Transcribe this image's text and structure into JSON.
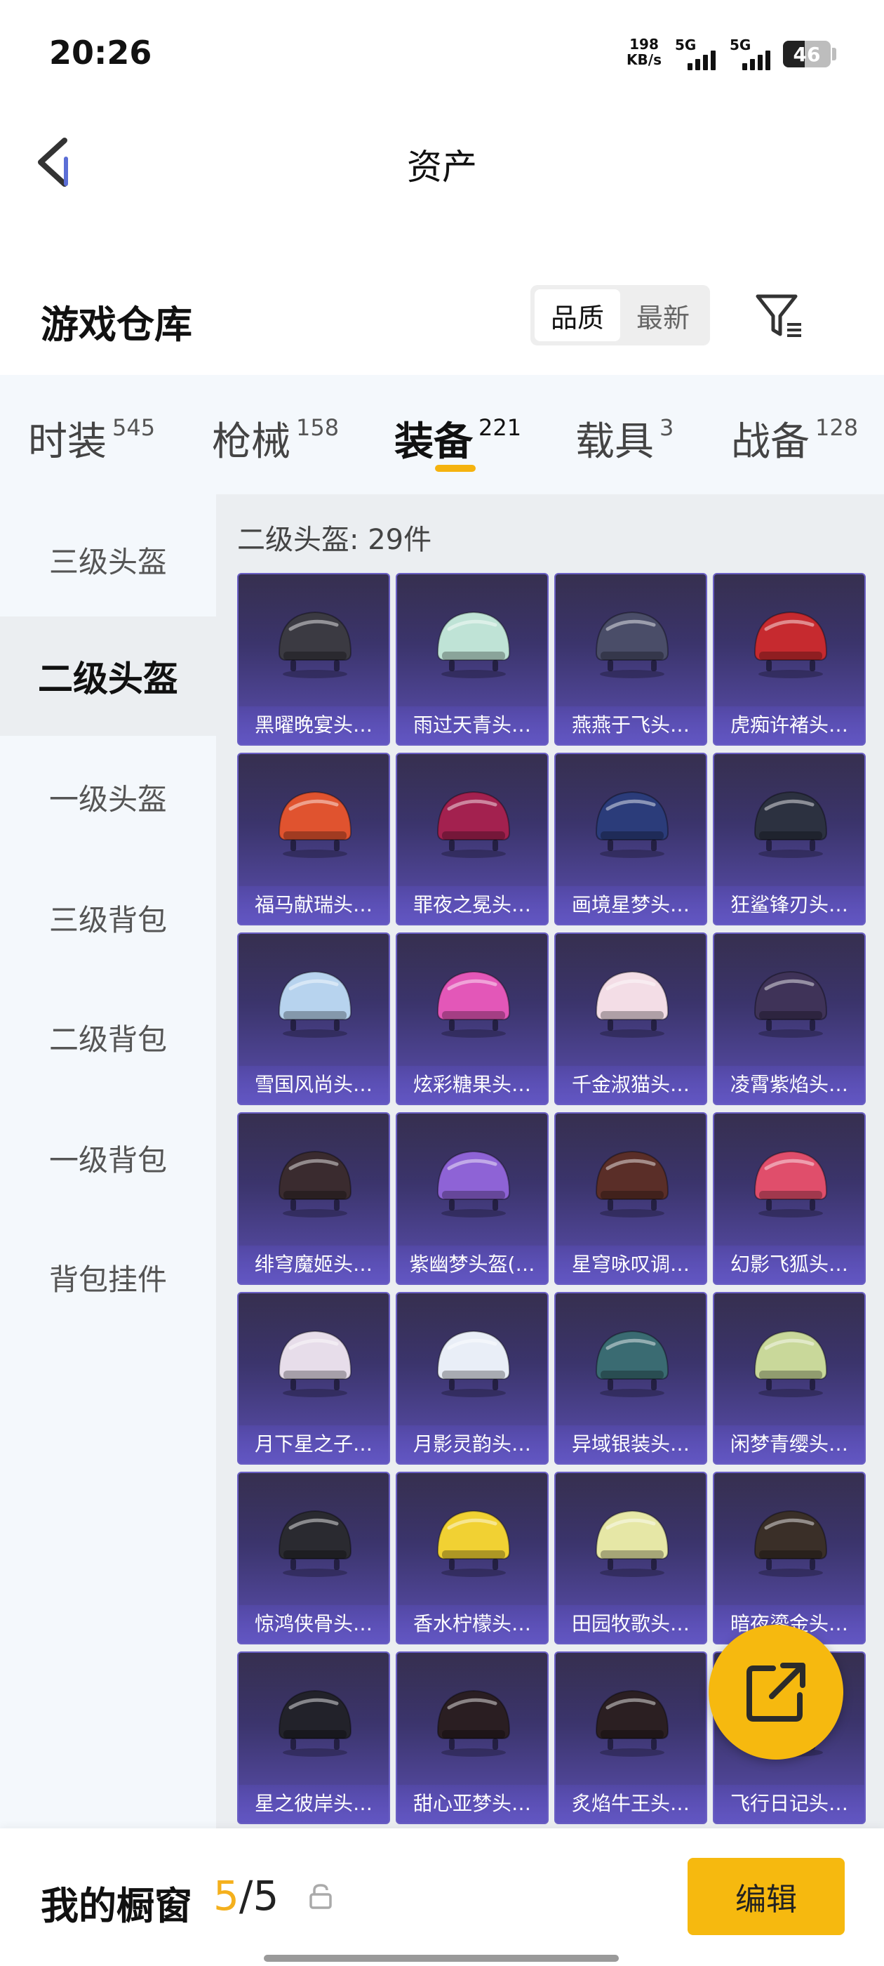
{
  "status_bar": {
    "time": "20:26",
    "net_speed_value": "198",
    "net_speed_unit": "KB/s",
    "signal1_label": "5G",
    "signal2_label": "5G",
    "battery": "46",
    "battery_level": 0.46
  },
  "nav": {
    "title": "资产",
    "back_icon": "chevron-left-icon"
  },
  "header": {
    "title": "游戏仓库",
    "sort_options": [
      "品质",
      "最新"
    ],
    "sort_selected": "品质",
    "filter_icon": "filter-icon"
  },
  "tabs": [
    {
      "label": "时装",
      "count": "545"
    },
    {
      "label": "枪械",
      "count": "158"
    },
    {
      "label": "装备",
      "count": "221"
    },
    {
      "label": "载具",
      "count": "3"
    },
    {
      "label": "战备",
      "count": "128"
    }
  ],
  "active_tab": "装备",
  "sidebar": {
    "items": [
      "三级头盔",
      "二级头盔",
      "一级头盔",
      "三级背包",
      "二级背包",
      "一级背包",
      "背包挂件"
    ],
    "active": "二级头盔"
  },
  "grid": {
    "header": "二级头盔: 29件",
    "items": [
      {
        "name": "黑曜晚宴头…",
        "color": "#3b3a42"
      },
      {
        "name": "雨过天青头…",
        "color": "#bfe3d6"
      },
      {
        "name": "燕燕于飞头…",
        "color": "#4a4d68"
      },
      {
        "name": "虎痴许褚头…",
        "color": "#c62a2f"
      },
      {
        "name": "福马献瑞头…",
        "color": "#e0532f"
      },
      {
        "name": "罪夜之冕头…",
        "color": "#a3214f"
      },
      {
        "name": "画境星梦头…",
        "color": "#2b3c7a"
      },
      {
        "name": "狂鲨锋刃头…",
        "color": "#2c3140"
      },
      {
        "name": "雪国风尚头…",
        "color": "#b7d3ee"
      },
      {
        "name": "炫彩糖果头…",
        "color": "#e357b8"
      },
      {
        "name": "千金淑猫头…",
        "color": "#f3dde6"
      },
      {
        "name": "凌霄紫焰头…",
        "color": "#3f3358"
      },
      {
        "name": "绯穹魔姬头…",
        "color": "#3a2b2f"
      },
      {
        "name": "紫幽梦头盔(…",
        "color": "#8e63d6"
      },
      {
        "name": "星穹咏叹调…",
        "color": "#5a2e28"
      },
      {
        "name": "幻影飞狐头…",
        "color": "#e04e6b"
      },
      {
        "name": "月下星之子…",
        "color": "#e7ddea"
      },
      {
        "name": "月影灵韵头…",
        "color": "#e9eef7"
      },
      {
        "name": "异域银装头…",
        "color": "#3a6b72"
      },
      {
        "name": "闲梦青缨头…",
        "color": "#c9d89a"
      },
      {
        "name": "惊鸿侠骨头…",
        "color": "#2a2a30"
      },
      {
        "name": "香水柠檬头…",
        "color": "#f1d133"
      },
      {
        "name": "田园牧歌头…",
        "color": "#e6e7a6"
      },
      {
        "name": "暗夜鎏金头…",
        "color": "#3a2f28"
      },
      {
        "name": "星之彼岸头…",
        "color": "#22222a"
      },
      {
        "name": "甜心亚梦头…",
        "color": "#2a1e22"
      },
      {
        "name": "炙焰牛王头…",
        "color": "#2b1f22"
      },
      {
        "name": "飞行日记头…",
        "color": "#3c3560"
      }
    ]
  },
  "fab": {
    "icon": "share-icon"
  },
  "bottom": {
    "label": "我的橱窗",
    "current": "5",
    "total": "/5",
    "lock_icon": "lock-icon",
    "edit_label": "编辑"
  },
  "colors": {
    "accent": "#f6b90f",
    "card_border": "#6a5fc4"
  }
}
